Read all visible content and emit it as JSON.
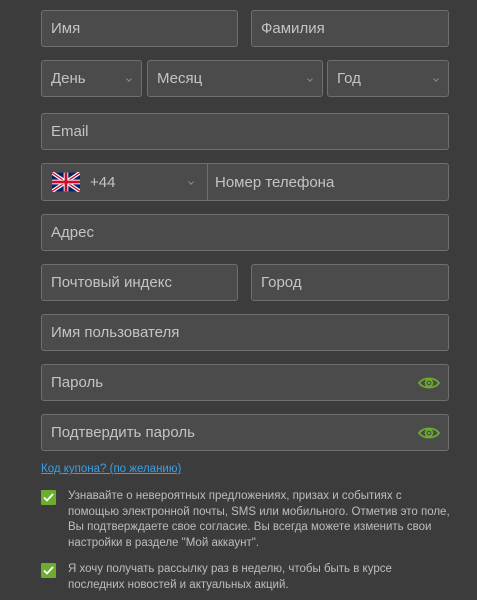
{
  "form": {
    "first_name_placeholder": "Имя",
    "last_name_placeholder": "Фамилия",
    "day_placeholder": "День",
    "month_placeholder": "Месяц",
    "year_placeholder": "Год",
    "email_placeholder": "Email",
    "phone_code": "+44",
    "phone_flag_icon": "uk-flag-icon",
    "phone_placeholder": "Номер телефона",
    "address_placeholder": "Адрес",
    "postal_code_placeholder": "Почтовый индекс",
    "city_placeholder": "Город",
    "username_placeholder": "Имя пользователя",
    "password_placeholder": "Пароль",
    "confirm_password_placeholder": "Подтвердить пароль",
    "eye_icon": "eye-icon",
    "coupon_link": "Код купона? (по желанию)"
  },
  "consents": [
    {
      "checked": true,
      "text": "Узнавайте о невероятных предложениях, призах и событиях с помощью электронной почты, SMS или мобильного. Отметив это поле, Вы подтверждаете свое согласие. Вы всегда можете изменить свои настройки в разделе \"Мой аккаунт\"."
    },
    {
      "checked": true,
      "text": "Я хочу получать рассылку раз в неделю, чтобы быть в курсе последних новостей и актуальных акций."
    }
  ],
  "colors": {
    "background": "#3c3c3c",
    "field_bg": "#4b4b4b",
    "field_border": "#6f6f6f",
    "accent_green": "#6cad2f",
    "link_blue": "#3aa0e6"
  }
}
